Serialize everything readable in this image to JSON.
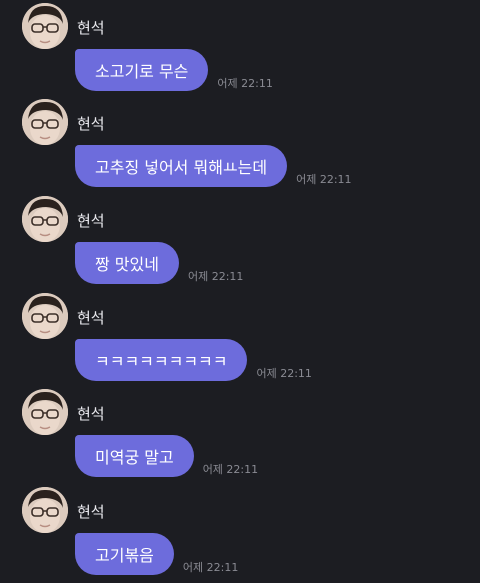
{
  "colors": {
    "background": "#1c1d22",
    "bubble": "#6d6cdc",
    "sender_text": "#e9e9ee",
    "time_text": "#8a8b93"
  },
  "messages": [
    {
      "sender": "현석",
      "avatar": "profile-photo",
      "text": "소고기로 무슨",
      "time": "어제 22:11"
    },
    {
      "sender": "현석",
      "avatar": "profile-photo",
      "text": "고추징 넣어서 뭐해ㅛ는데",
      "time": "어제 22:11"
    },
    {
      "sender": "현석",
      "avatar": "profile-photo",
      "text": "짱 맛있네",
      "time": "어제 22:11"
    },
    {
      "sender": "현석",
      "avatar": "profile-photo",
      "text": "ㅋㅋㅋㅋㅋㅋㅋㅋㅋ",
      "time": "어제 22:11"
    },
    {
      "sender": "현석",
      "avatar": "profile-photo",
      "text": "미역궁 말고",
      "time": "어제 22:11"
    },
    {
      "sender": "현석",
      "avatar": "profile-photo",
      "text": "고기볶음",
      "time": "어제 22:11"
    }
  ]
}
